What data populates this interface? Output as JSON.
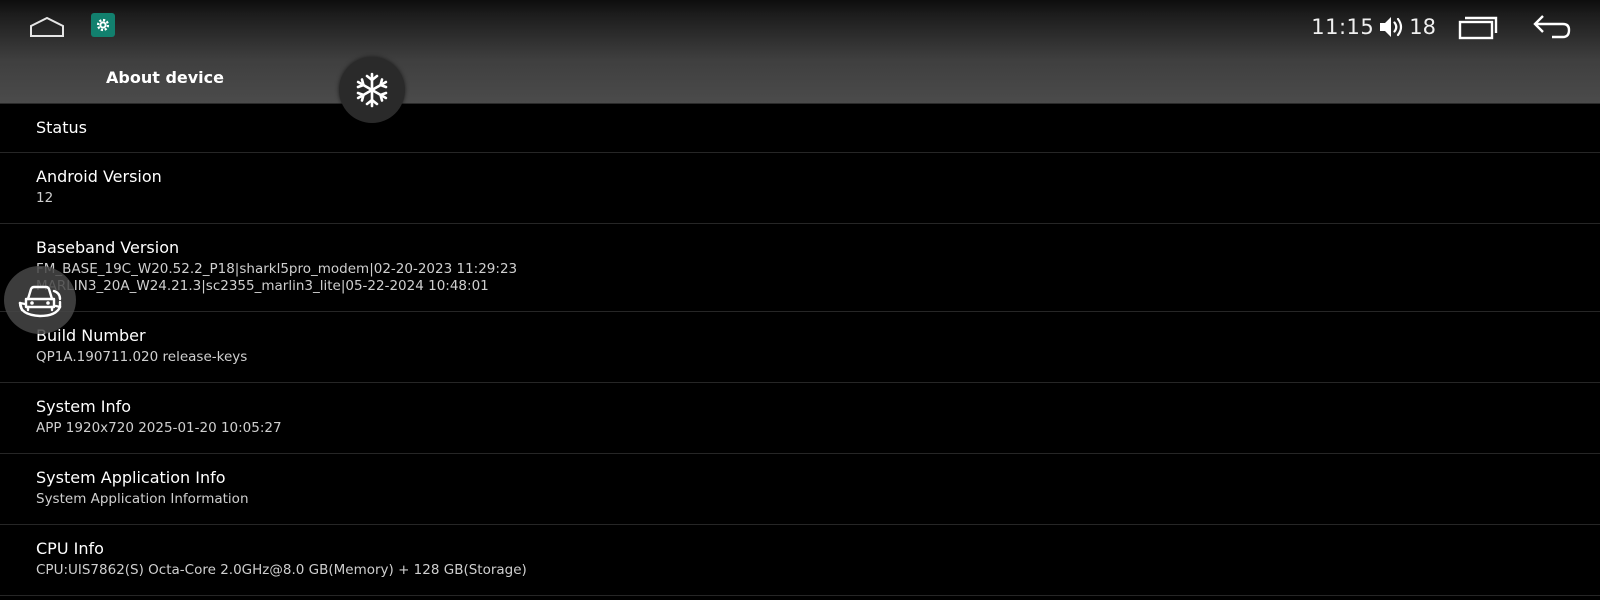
{
  "status_bar": {
    "time": "11:15",
    "volume_level": "18"
  },
  "header": {
    "title": "About device"
  },
  "items": [
    {
      "title": "Status",
      "lines": []
    },
    {
      "title": "Android Version",
      "lines": [
        "12"
      ]
    },
    {
      "title": "Baseband Version",
      "lines": [
        "FM_BASE_19C_W20.52.2_P18|sharkl5pro_modem|02-20-2023 11:29:23",
        "MARLIN3_20A_W24.21.3|sc2355_marlin3_lite|05-22-2024 10:48:01"
      ]
    },
    {
      "title": "Build Number",
      "lines": [
        "QP1A.190711.020 release-keys"
      ]
    },
    {
      "title": "System Info",
      "lines": [
        "APP 1920x720 2025-01-20 10:05:27"
      ]
    },
    {
      "title": "System Application Info",
      "lines": [
        "System Application Information"
      ]
    },
    {
      "title": "CPU Info",
      "lines": [
        "CPU:UIS7862(S) Octa-Core 2.0GHz@8.0 GB(Memory) + 128 GB(Storage)"
      ]
    }
  ],
  "icons": {
    "home": "home-icon",
    "app": "settings-gear-icon",
    "volume": "volume-icon",
    "recents": "recents-icon",
    "back": "back-arrow-icon",
    "freeze": "snowflake-icon",
    "car_camera": "car-rotate-icon"
  },
  "colors": {
    "app_icon_bg": "#12806e",
    "background": "#000000",
    "divider": "#262626"
  }
}
